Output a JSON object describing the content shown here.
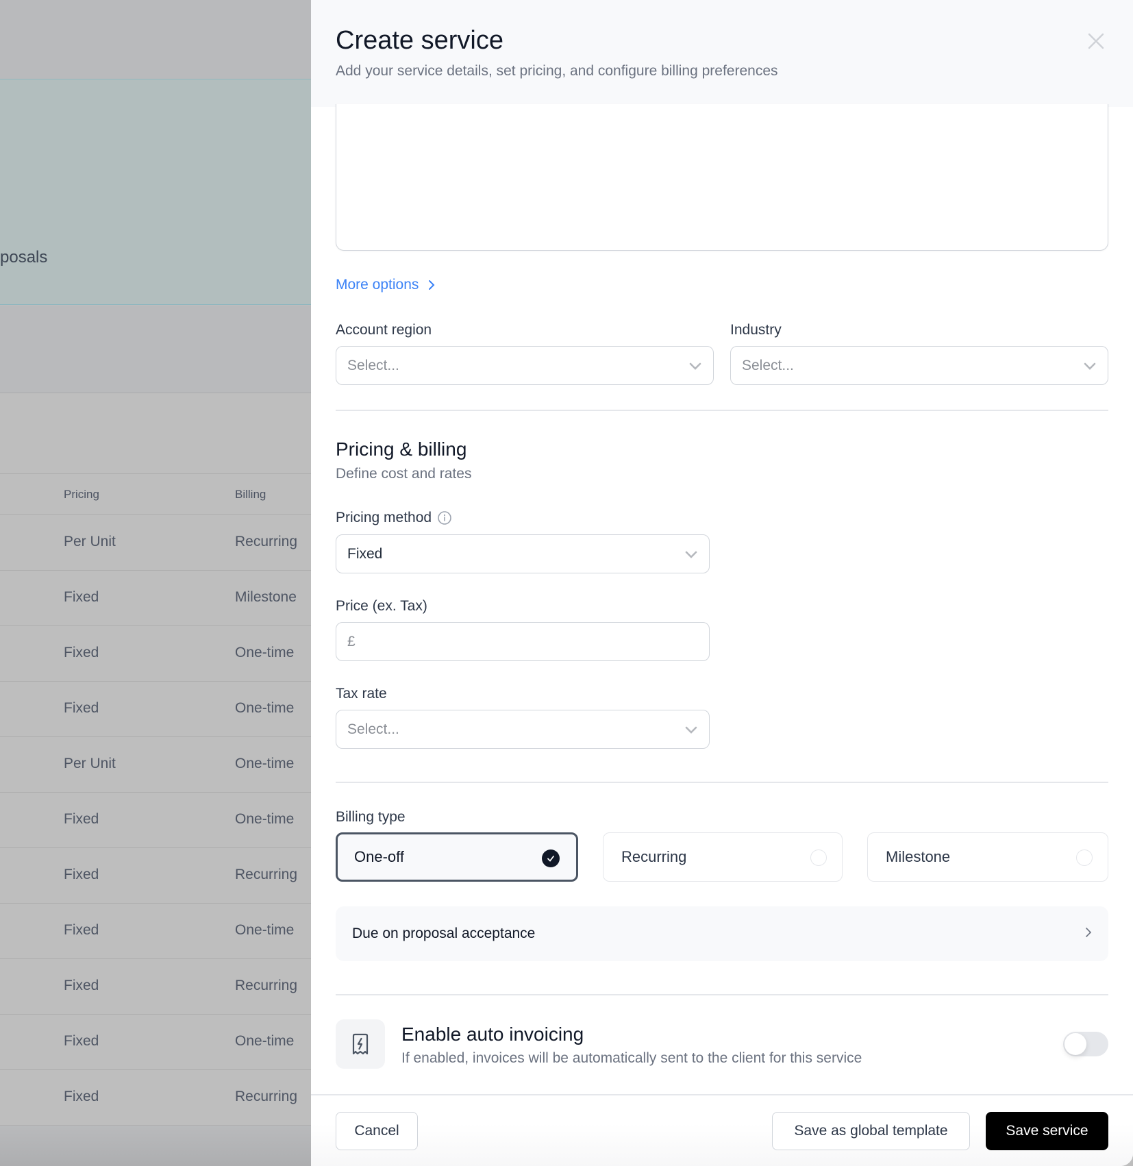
{
  "background": {
    "hero_text": "posals",
    "table": {
      "headers": [
        "Pricing",
        "Billing"
      ],
      "rows": [
        [
          "Per Unit",
          "Recurring"
        ],
        [
          "Fixed",
          "Milestone"
        ],
        [
          "Fixed",
          "One-time"
        ],
        [
          "Fixed",
          "One-time"
        ],
        [
          "Per Unit",
          "One-time"
        ],
        [
          "Fixed",
          "One-time"
        ],
        [
          "Fixed",
          "Recurring"
        ],
        [
          "Fixed",
          "One-time"
        ],
        [
          "Fixed",
          "Recurring"
        ],
        [
          "Fixed",
          "One-time"
        ],
        [
          "Fixed",
          "Recurring"
        ]
      ]
    }
  },
  "panel": {
    "title": "Create service",
    "subtitle": "Add your service details, set pricing, and configure billing preferences",
    "close_icon": "close-icon",
    "more_options": "More options",
    "account_region": {
      "label": "Account region",
      "placeholder": "Select..."
    },
    "industry": {
      "label": "Industry",
      "placeholder": "Select..."
    },
    "pricing_section": {
      "title": "Pricing & billing",
      "subtitle": "Define cost and rates"
    },
    "pricing_method": {
      "label": "Pricing method",
      "value": "Fixed",
      "info_icon": "info-icon"
    },
    "price": {
      "label": "Price (ex. Tax)",
      "currency": "£",
      "value": ""
    },
    "tax_rate": {
      "label": "Tax rate",
      "placeholder": "Select..."
    },
    "billing_type": {
      "label": "Billing type",
      "options": [
        {
          "label": "One-off",
          "selected": true
        },
        {
          "label": "Recurring",
          "selected": false
        },
        {
          "label": "Milestone",
          "selected": false
        }
      ]
    },
    "due_row": "Due on proposal acceptance",
    "auto_invoicing": {
      "title": "Enable auto invoicing",
      "subtitle": "If enabled, invoices will be automatically sent to the client for this service",
      "enabled": false,
      "icon": "receipt-lightning-icon"
    },
    "footer": {
      "cancel": "Cancel",
      "save_template": "Save as global template",
      "save": "Save service"
    }
  },
  "colors": {
    "accent_link": "#3b82f6",
    "primary_button": "#000000",
    "selected_border": "#4b5563"
  }
}
